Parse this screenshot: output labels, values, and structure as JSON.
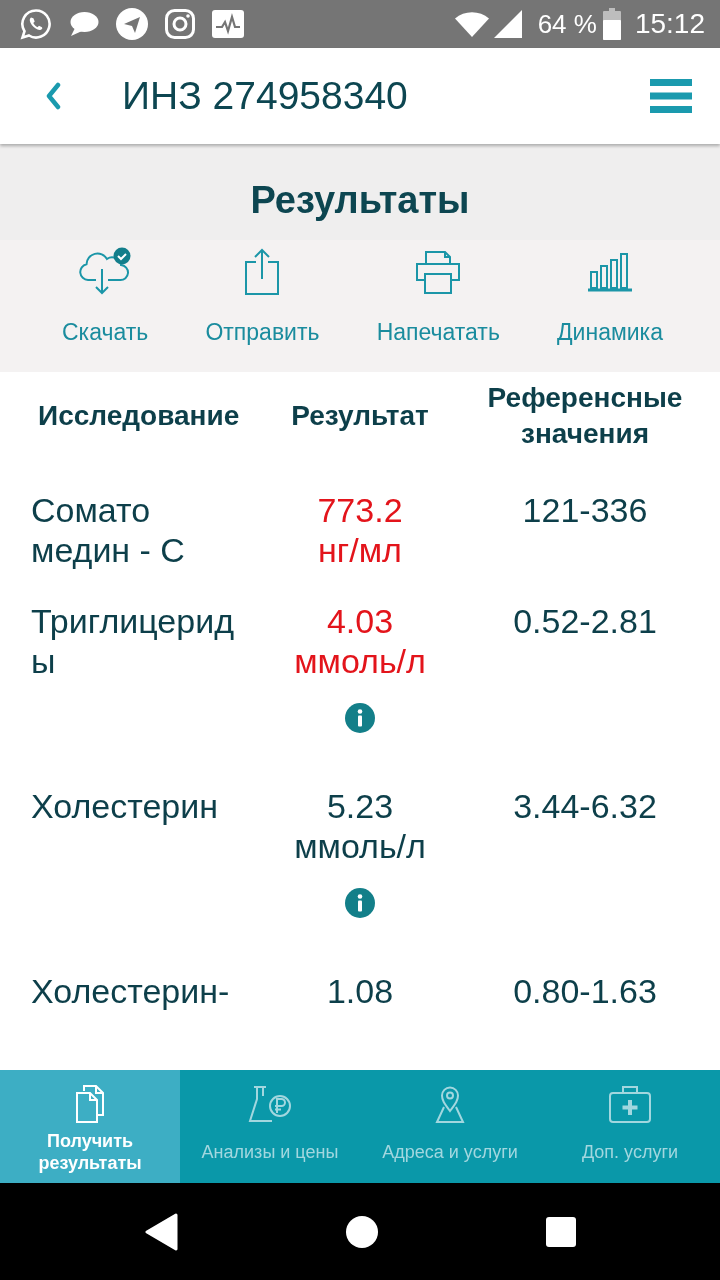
{
  "status_bar": {
    "battery": "64 %",
    "time": "15:12"
  },
  "header": {
    "title": "ИНЗ 274958340"
  },
  "section": {
    "title": "Результаты"
  },
  "actions": [
    {
      "kind": "download",
      "label": "Скачать"
    },
    {
      "kind": "send",
      "label": "Отправить"
    },
    {
      "kind": "print",
      "label": "Напечатать"
    },
    {
      "kind": "dynamics",
      "label": "Динамика"
    }
  ],
  "table": {
    "columns": [
      "Исследование",
      "Результат",
      "Референсные значения"
    ],
    "rows": [
      {
        "name": "Сомато медин - С",
        "value": "773.2",
        "unit": "нг/мл",
        "reference": "121-336",
        "abnormal": true,
        "info": false
      },
      {
        "name": "Триглицериды",
        "value": "4.03",
        "unit": "ммоль/л",
        "reference": "0.52-2.81",
        "abnormal": true,
        "info": true
      },
      {
        "name": "Холестерин",
        "value": "5.23",
        "unit": "ммоль/л",
        "reference": "3.44-6.32",
        "abnormal": false,
        "info": true
      },
      {
        "name": "Холестерин-",
        "value": "1.08",
        "reference": "0.80-1.63",
        "abnormal": false,
        "info": false
      }
    ]
  },
  "bottom_nav": [
    {
      "kind": "results",
      "label": "Получить результаты",
      "selected": true
    },
    {
      "kind": "tests",
      "label": "Анализы и цены",
      "selected": false
    },
    {
      "kind": "addresses",
      "label": "Адреса и услуги",
      "selected": false
    },
    {
      "kind": "services",
      "label": "Доп. услуги",
      "selected": false
    }
  ]
}
